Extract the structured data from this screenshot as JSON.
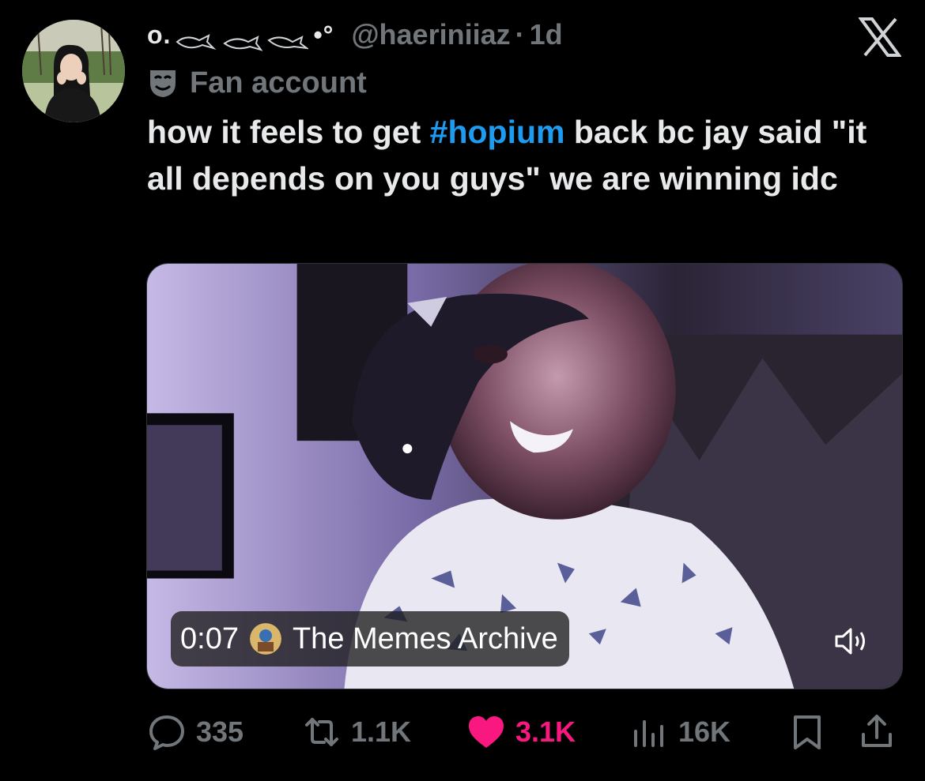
{
  "author": {
    "display_name": "o. ··· ·°",
    "display_prefix": "o.",
    "display_suffix": "•°",
    "handle": "@haeriniiaz",
    "separator": "·",
    "time_ago": "1d",
    "avatar_icon": "profile-photo",
    "account_label": "Fan account",
    "account_label_icon": "theater-mask-icon"
  },
  "tweet": {
    "text_before": "how it feels to get ",
    "hashtag": "#hopium",
    "text_after": " back bc jay said \"it all depends on you guys\" we are winning idc"
  },
  "media": {
    "duration": "0:07",
    "source_name": "The Memes Archive",
    "volume_icon": "speaker-icon"
  },
  "actions": {
    "replies": "335",
    "retweets": "1.1K",
    "likes": "3.1K",
    "views": "16K"
  },
  "colors": {
    "background": "#000000",
    "text": "#e7e9ea",
    "muted": "#71767b",
    "link": "#1d9bf0",
    "like": "#f91880"
  },
  "brand": "X"
}
